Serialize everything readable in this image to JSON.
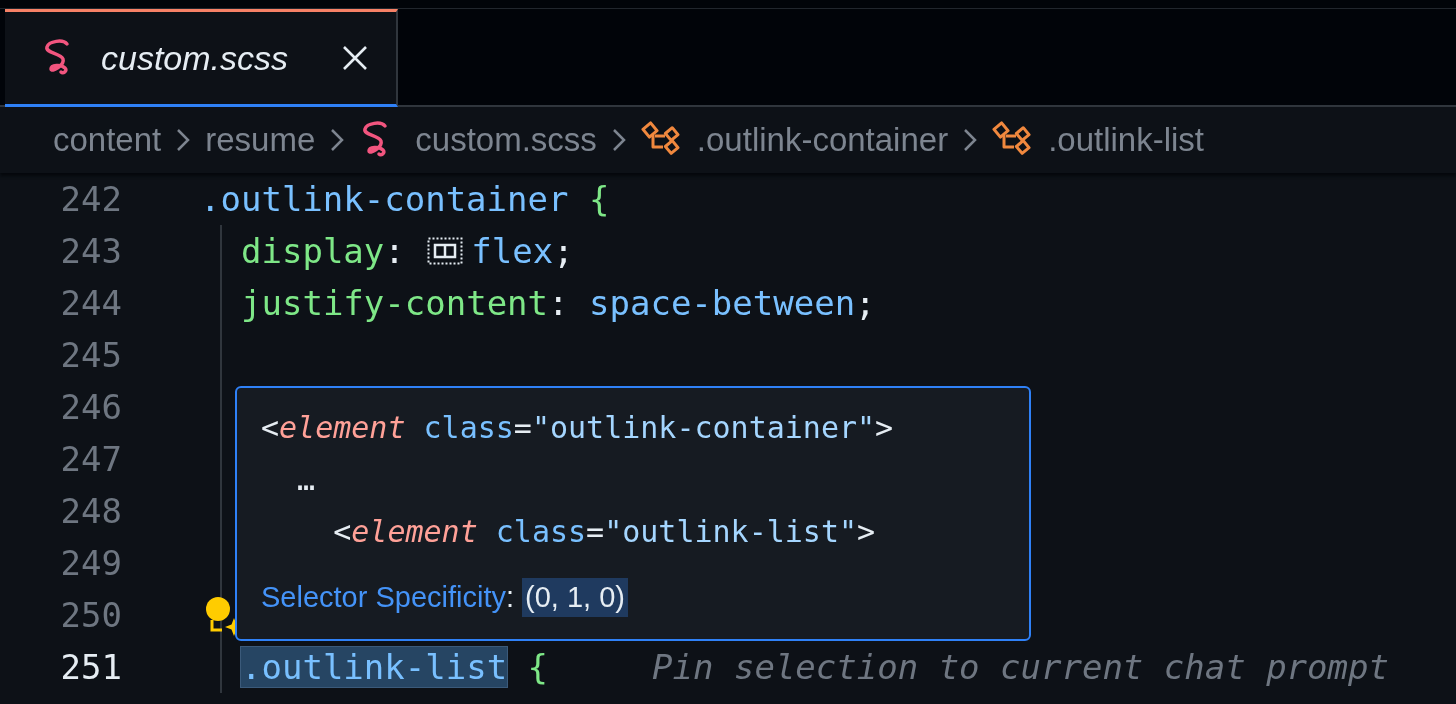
{
  "tab": {
    "label": "custom.scss",
    "selected": true
  },
  "breadcrumbs": [
    {
      "label": "content",
      "kind": "folder"
    },
    {
      "label": "resume",
      "kind": "folder"
    },
    {
      "label": "custom.scss",
      "kind": "file"
    },
    {
      "label": ".outlink-container",
      "kind": "symbol"
    },
    {
      "label": ".outlink-list",
      "kind": "symbol"
    }
  ],
  "editor": {
    "lines": [
      {
        "number": "242",
        "current": false,
        "indented": false,
        "tokens": [
          {
            "kind": "selector",
            "text": ".outlink-container"
          },
          {
            "kind": "brace",
            "text": "{"
          }
        ]
      },
      {
        "number": "243",
        "current": false,
        "indented": true,
        "tokens": [
          {
            "kind": "property",
            "text": "display"
          },
          {
            "kind": "plain",
            "text": ":"
          },
          {
            "kind": "layout-icon"
          },
          {
            "kind": "value",
            "text": "flex"
          },
          {
            "kind": "plain",
            "text": ";"
          }
        ]
      },
      {
        "number": "244",
        "current": false,
        "indented": true,
        "tokens": [
          {
            "kind": "property",
            "text": "justify-content"
          },
          {
            "kind": "plain",
            "text": ":"
          },
          {
            "kind": "value",
            "text": "space-between"
          },
          {
            "kind": "plain",
            "text": ";"
          }
        ]
      },
      {
        "number": "245",
        "current": false,
        "indented": true
      },
      {
        "number": "246",
        "current": false,
        "indented": true
      },
      {
        "number": "247",
        "current": false,
        "indented": true
      },
      {
        "number": "248",
        "current": false,
        "indented": true
      },
      {
        "number": "249",
        "current": false,
        "indented": true
      },
      {
        "number": "250",
        "current": false,
        "indented": true,
        "tokens": [
          {
            "kind": "lightbulb"
          }
        ]
      },
      {
        "number": "251",
        "current": true,
        "indented": true,
        "tokens": [
          {
            "kind": "selection",
            "text": ".outlink-list"
          },
          {
            "kind": "brace",
            "text": "{"
          },
          {
            "kind": "hint",
            "text": "Pin selection to current chat prompt"
          }
        ]
      }
    ]
  },
  "hover": {
    "lines": [
      {
        "tokens": [
          {
            "kind": "plain",
            "text": "<"
          },
          {
            "kind": "tag",
            "text": "element"
          },
          {
            "kind": "attr",
            "text": "class"
          },
          {
            "kind": "plain",
            "text": "="
          },
          {
            "kind": "string",
            "text": "\"outlink-container\""
          },
          {
            "kind": "plain",
            "text": ">"
          }
        ],
        "children": [
          {
            "tokens": [
              {
                "kind": "plain",
                "text": "…"
              }
            ],
            "children": [
              {
                "tokens": [
                  {
                    "kind": "plain",
                    "text": "<"
                  },
                  {
                    "kind": "tag",
                    "text": "element"
                  },
                  {
                    "kind": "attr",
                    "text": "class"
                  },
                  {
                    "kind": "plain",
                    "text": "="
                  },
                  {
                    "kind": "string",
                    "text": "\"outlink-list\""
                  },
                  {
                    "kind": "plain",
                    "text": ">"
                  }
                ]
              }
            ]
          }
        ]
      }
    ],
    "label": "Selector Specificity",
    "separator": ":",
    "value": "(0, 1, 0)"
  }
}
